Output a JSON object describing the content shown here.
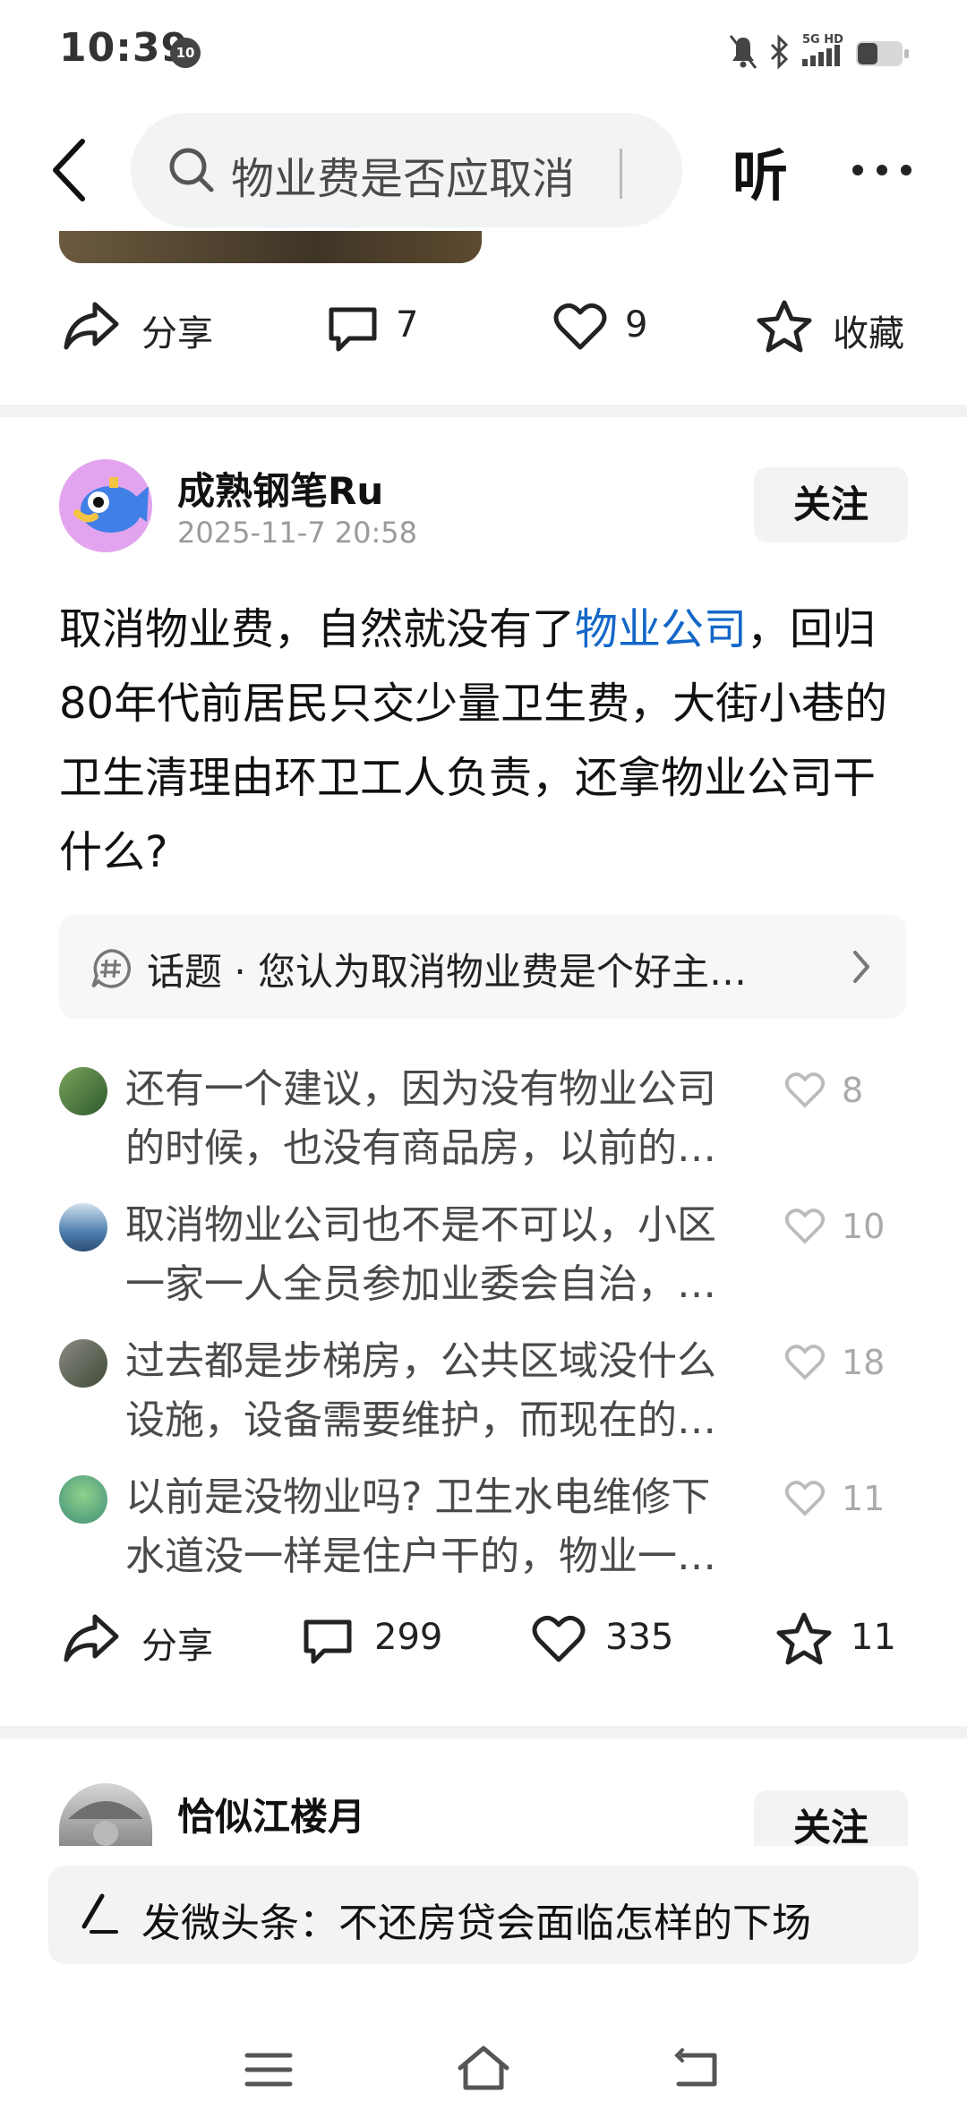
{
  "status_bar": {
    "time": "10:39",
    "notif_badge": "10",
    "network_label": "5G HD"
  },
  "top_nav": {
    "search_text": "物业费是否应取消",
    "listen_label": "听"
  },
  "prev_post_actions": {
    "share_label": "分享",
    "comments": "7",
    "likes": "9",
    "favorite_label": "收藏"
  },
  "post": {
    "username": "成熟钢笔Ru",
    "time": "2025-11-7 20:58",
    "follow_label": "关注",
    "body_before_link": "取消物业费，自然就没有了",
    "body_link": "物业公司",
    "body_after_link": "，回归80年代前居民只交少量卫生费，大街小巷的卫生清理由环卫工人负责，还拿物业公司干什么?",
    "topic_label": "话题 · 您认为取消物业费是个好主…",
    "comments": [
      {
        "line1": "还有一个建议，因为没有物业公司",
        "line2": "的时候，也没有商品房，以前的…",
        "likes": "8"
      },
      {
        "line1": "取消物业公司也不是不可以，小区",
        "line2": "一家一人全员参加业委会自治，…",
        "likes": "10"
      },
      {
        "line1": "过去都是步梯房，公共区域没什么",
        "line2": "设施，设备需要维护，而现在的…",
        "likes": "18"
      },
      {
        "line1": "以前是没物业吗? 卫生水电维修下",
        "line2": "水道没一样是住户干的，物业一…",
        "likes": "11"
      }
    ],
    "actions": {
      "share_label": "分享",
      "comments": "299",
      "likes": "335",
      "favorites": "11"
    }
  },
  "next_post": {
    "username": "恰似江楼月",
    "follow_label": "关注"
  },
  "compose": {
    "text": "发微头条：不还房贷会面临怎样的下场"
  },
  "colors": {
    "link": "#1467c8",
    "muted": "#9a9a9a",
    "pill_bg": "#f2f3f5"
  }
}
